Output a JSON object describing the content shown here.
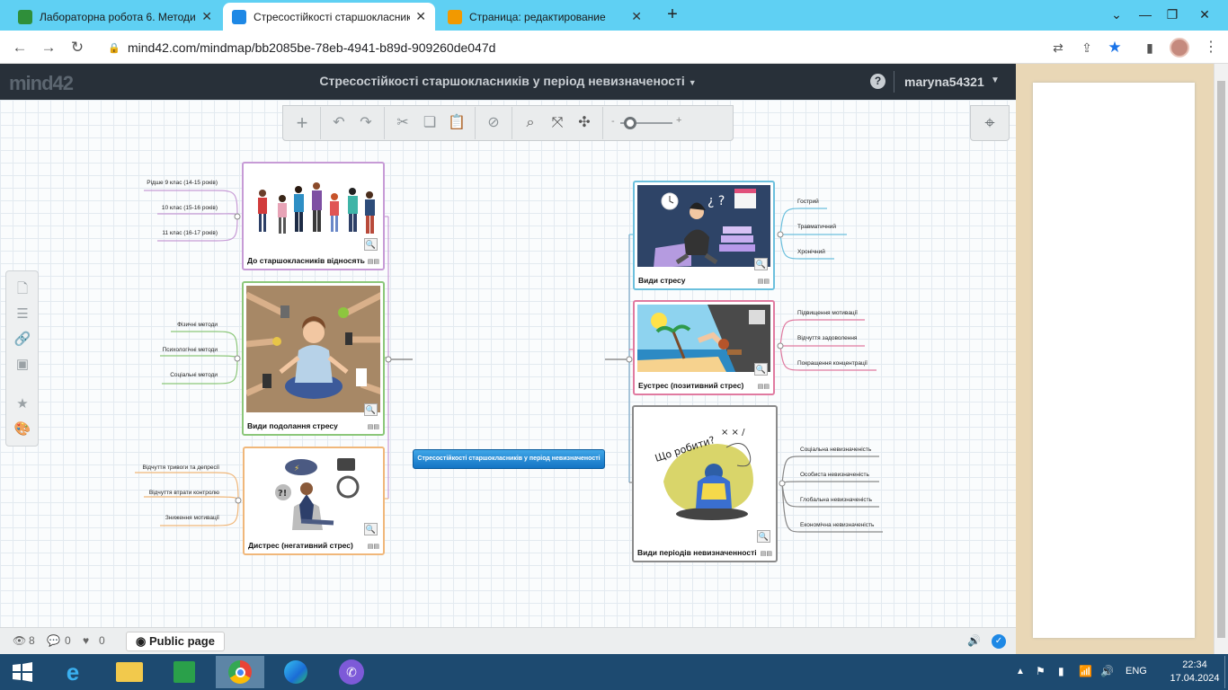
{
  "browser": {
    "tabs": [
      {
        "title": "Лабораторна робота 6. Методи",
        "color": "#2f8f3a"
      },
      {
        "title": "Стресостійкості старшокласникі",
        "color": "#1e88e5"
      },
      {
        "title": "Страница: редактирование",
        "color": "#f29900"
      }
    ],
    "url": "mind42.com/mindmap/bb2085be-78eb-4941-b89d-909260de047d"
  },
  "app": {
    "logo": "mind42",
    "map_title": "Стресостійкості старшокласників у період невизначеності",
    "username": "maryna54321"
  },
  "mindmap": {
    "center": "Стресостійкості старшокласників у період невизначеності",
    "nodes": {
      "students": {
        "caption": "До старшокласників відносять",
        "leaves": [
          "Рідше 9 клас (14-15 років)",
          "10 клас (15-16 років)",
          "11 клас (16-17 років)"
        ]
      },
      "coping": {
        "caption": "Види подолання стресу",
        "leaves": [
          "Фізичні методи",
          "Психологічні методи",
          "Соціальні методи"
        ]
      },
      "distress": {
        "caption": "Дистрес (негативний стрес)",
        "leaves": [
          "Відчуття тривоги та депресії",
          "Відчуття втрати контролю",
          "Зниження мотивації"
        ]
      },
      "stress_types": {
        "caption": "Види стресу",
        "leaves": [
          "Гострий",
          "Травматичний",
          "Хронічний"
        ]
      },
      "eustress": {
        "caption": "Еустрес (позитивний стрес)",
        "leaves": [
          "Підвищення мотивації",
          "Відчуття задоволення",
          "Покращення концентрації"
        ]
      },
      "uncertainty": {
        "caption": "Види періодів невизначенності",
        "image_text": "Що робити?",
        "leaves": [
          "Соціальна невизначеність",
          "Особиста невизначеність",
          "Глобальна невизначеність",
          "Економічна невизначеність"
        ]
      }
    }
  },
  "status": {
    "views": "8",
    "comments": "0",
    "likes": "0",
    "public_label": "Public page"
  },
  "taskbar": {
    "lang": "ENG",
    "time": "22:34",
    "date": "17.04.2024"
  }
}
